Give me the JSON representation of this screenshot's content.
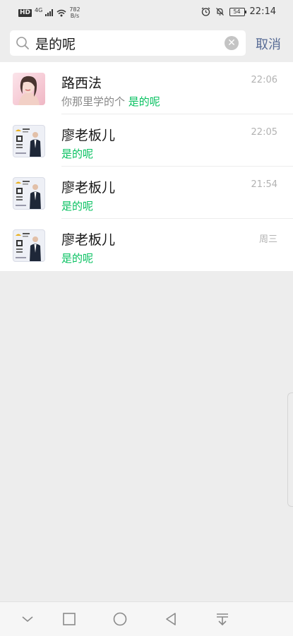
{
  "status_bar": {
    "hd": "HD",
    "signal": "4G",
    "net_speed_value": "782",
    "net_speed_unit": "B/s",
    "battery": "54",
    "time": "22:14"
  },
  "search": {
    "query": "是的呢",
    "cancel_label": "取消"
  },
  "results": [
    {
      "name": "路西法",
      "time": "22:06",
      "msg_prefix": "你那里学的个 ",
      "msg_match": "是的呢",
      "avatar": "portrait"
    },
    {
      "name": "廖老板儿",
      "time": "22:05",
      "msg_prefix": "",
      "msg_match": "是的呢",
      "avatar": "business-card"
    },
    {
      "name": "廖老板儿",
      "time": "21:54",
      "msg_prefix": "",
      "msg_match": "是的呢",
      "avatar": "business-card"
    },
    {
      "name": "廖老板儿",
      "time": "周三",
      "msg_prefix": "",
      "msg_match": "是的呢",
      "avatar": "business-card"
    }
  ],
  "colors": {
    "background": "#ededed",
    "highlight": "#07c160",
    "link": "#576b95",
    "secondary_text": "#888888",
    "timestamp": "#b2b2b2"
  },
  "nav": [
    "chevron-down-icon",
    "recents-square-icon",
    "home-circle-icon",
    "back-triangle-icon",
    "notification-pulldown-icon"
  ]
}
